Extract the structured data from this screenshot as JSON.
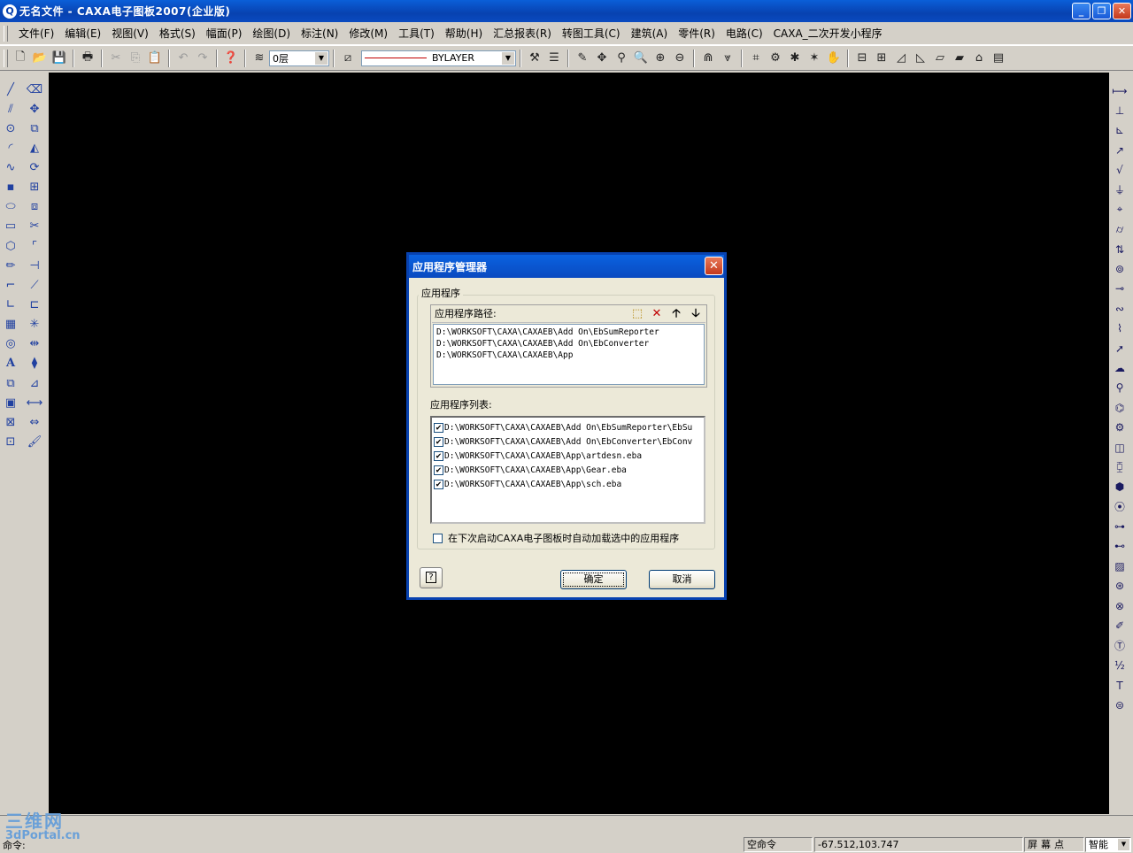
{
  "window": {
    "title": "无名文件 - CAXA电子图板2007(企业版)"
  },
  "menu": [
    "文件(F)",
    "编辑(E)",
    "视图(V)",
    "格式(S)",
    "幅面(P)",
    "绘图(D)",
    "标注(N)",
    "修改(M)",
    "工具(T)",
    "帮助(H)",
    "汇总报表(R)",
    "转图工具(C)",
    "建筑(A)",
    "零件(R)",
    "电路(C)",
    "CAXA_二次开发小程序"
  ],
  "toolbar": {
    "layer_value": "0层",
    "linetype_value": "BYLAYER"
  },
  "dialog": {
    "title": "应用程序管理器",
    "group_label": "应用程序",
    "path_label": "应用程序路径:",
    "paths": [
      "D:\\WORKSOFT\\CAXA\\CAXAEB\\Add On\\EbSumReporter",
      "D:\\WORKSOFT\\CAXA\\CAXAEB\\Add On\\EbConverter",
      "D:\\WORKSOFT\\CAXA\\CAXAEB\\App"
    ],
    "list_label": "应用程序列表:",
    "apps": [
      {
        "checked": true,
        "path": "D:\\WORKSOFT\\CAXA\\CAXAEB\\Add On\\EbSumReporter\\EbSu"
      },
      {
        "checked": true,
        "path": "D:\\WORKSOFT\\CAXA\\CAXAEB\\Add On\\EbConverter\\EbConv"
      },
      {
        "checked": true,
        "path": "D:\\WORKSOFT\\CAXA\\CAXAEB\\App\\artdesn.eba"
      },
      {
        "checked": true,
        "path": "D:\\WORKSOFT\\CAXA\\CAXAEB\\App\\Gear.eba"
      },
      {
        "checked": true,
        "path": "D:\\WORKSOFT\\CAXA\\CAXAEB\\App\\sch.eba"
      }
    ],
    "autoload_label": "在下次启动CAXA电子图板时自动加载选中的应用程序",
    "help_label": "?",
    "ok_label": "确定",
    "cancel_label": "取消"
  },
  "statusbar": {
    "command_prompt": "命令:",
    "command_state": "空命令",
    "coords": "-67.512,103.747",
    "snap_mode": "屏幕点",
    "smart_mode": "智能"
  },
  "watermark": {
    "line1": "三维网",
    "line2": "3dPortal.cn"
  }
}
